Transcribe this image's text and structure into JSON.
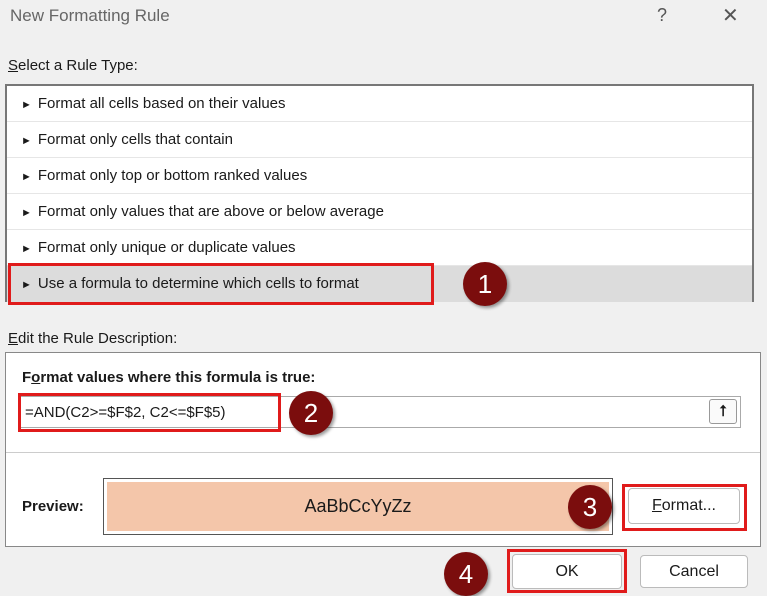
{
  "window": {
    "title": "New Formatting Rule",
    "help": "?",
    "close": "✕"
  },
  "rule_type": {
    "label_u": "S",
    "label_rest": "elect a Rule Type:",
    "items": [
      {
        "label": "Format all cells based on their values"
      },
      {
        "label": "Format only cells that contain"
      },
      {
        "label": "Format only top or bottom ranked values"
      },
      {
        "label": "Format only values that are above or below average"
      },
      {
        "label": "Format only unique or duplicate values"
      },
      {
        "label": "Use a formula to determine which cells to format",
        "selected": true
      }
    ]
  },
  "description": {
    "label_u": "E",
    "label_rest": "dit the Rule Description:",
    "formula_label_a": "F",
    "formula_label_u": "o",
    "formula_label_rest": "rmat values where this formula is true:",
    "formula_value": "=AND(C2>=$F$2, C2<=$F$5)",
    "collapse_icon": "⭡",
    "preview_label": "Preview:",
    "preview_text": "AaBbCcYyZz",
    "preview_color": "#f4c6aa",
    "format_u": "F",
    "format_rest": "ormat..."
  },
  "buttons": {
    "ok": "OK",
    "cancel": "Cancel"
  },
  "badges": [
    "1",
    "2",
    "3",
    "4"
  ],
  "accent": "#e01b1b"
}
